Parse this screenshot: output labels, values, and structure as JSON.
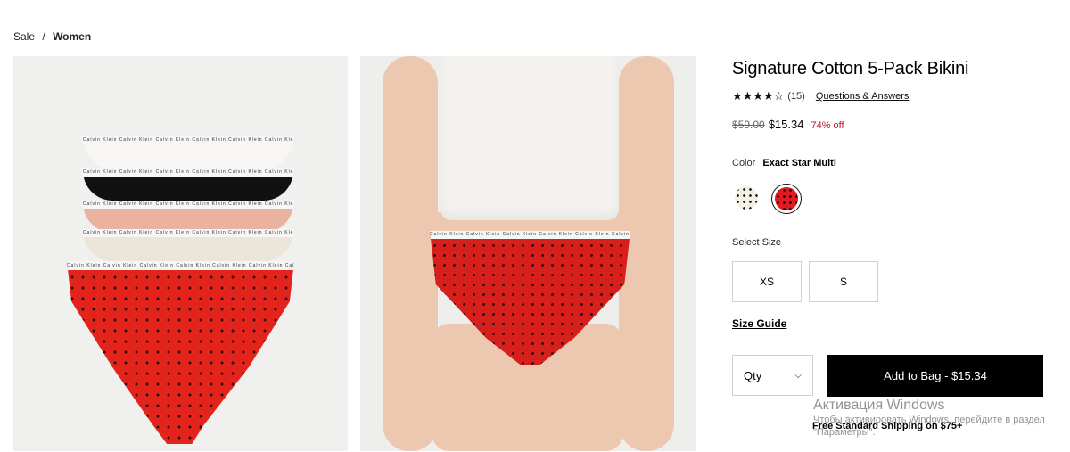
{
  "breadcrumb": {
    "parent": "Sale",
    "separator": "/",
    "current": "Women"
  },
  "gallery": {
    "waistband_text": "Calvin Klein  Calvin Klein  Calvin Klein  Calvin Klein  Calvin Klein  Calvin Klein  Calvin Klein"
  },
  "product": {
    "title": "Signature Cotton 5-Pack Bikini",
    "rating": {
      "stars": 4,
      "max_stars": 5,
      "stars_text": "★★★★☆",
      "count": "(15)"
    },
    "qa_link": "Questions & Answers",
    "price": {
      "original": "$59.00",
      "sale": "$15.34",
      "discount": "74% off"
    },
    "color": {
      "label": "Color",
      "value": "Exact Star Multi"
    },
    "swatches": [
      {
        "name": "cream-star",
        "color": "#f3efe4",
        "selected": false
      },
      {
        "name": "red-star",
        "color": "#e01a22",
        "selected": true
      }
    ],
    "size_label": "Select Size",
    "sizes": [
      "XS",
      "S"
    ],
    "size_guide": "Size Guide",
    "qty_label": "Qty",
    "add_to_bag": "Add to Bag - $15.34",
    "shipping": "Free Standard Shipping on $75+"
  },
  "watermark": {
    "title": "Активация Windows",
    "line1": "Чтобы активировать Windows, перейдите в раздел",
    "line2": "\"Параметры\"."
  }
}
